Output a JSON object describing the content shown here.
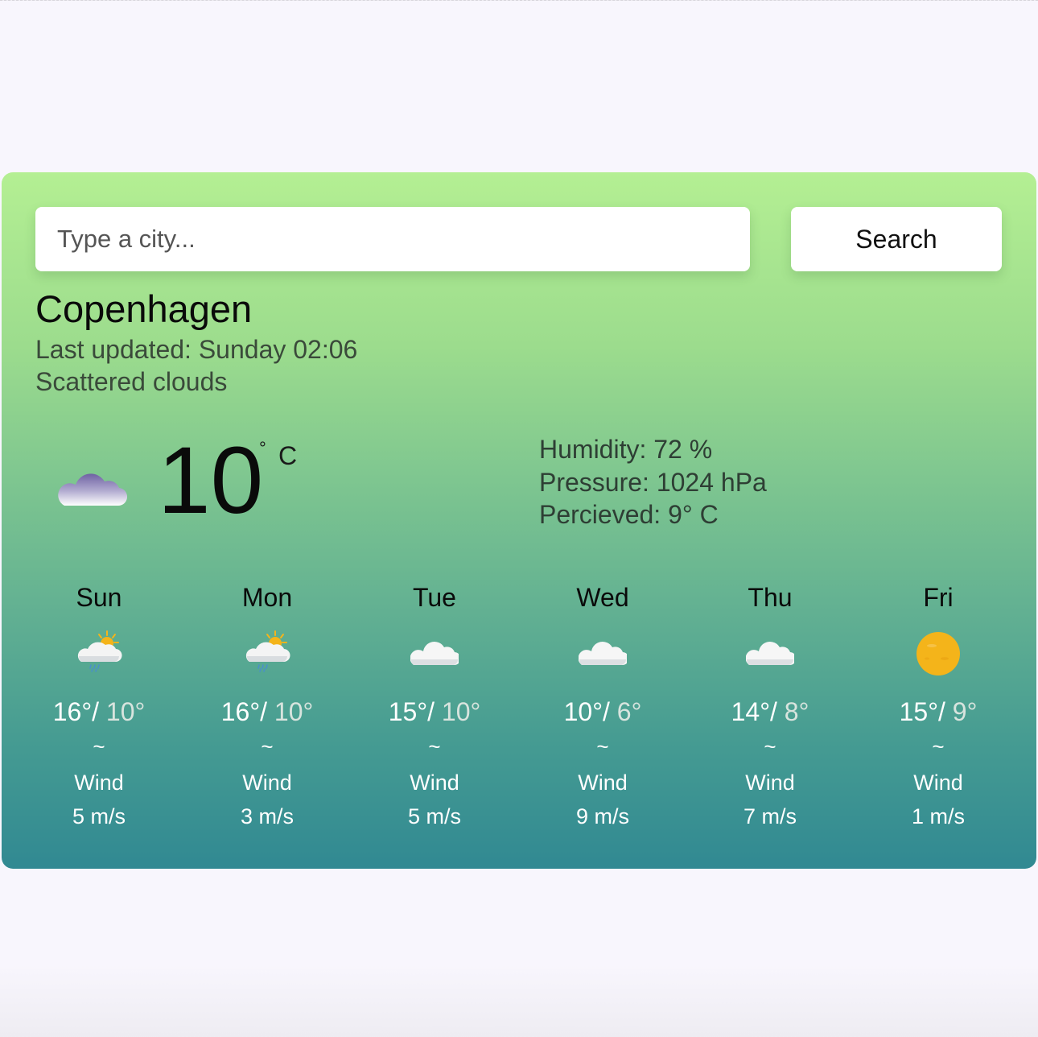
{
  "search": {
    "placeholder": "Type a city...",
    "button_label": "Search"
  },
  "current": {
    "city": "Copenhagen",
    "last_updated": "Last updated: Sunday 02:06",
    "description": "Scattered clouds",
    "icon": "cloud-icon",
    "temperature": "10",
    "degree_symbol": "°",
    "unit": "C",
    "humidity": "Humidity: 72 %",
    "pressure": "Pressure: 1024 hPa",
    "perceived": "Percieved: 9° C"
  },
  "forecast": [
    {
      "day": "Sun",
      "icon": "sun-cloud-rain-icon",
      "max": "16°",
      "min": "10°",
      "tilde": "~",
      "wind_label": "Wind",
      "wind": "5 m/s"
    },
    {
      "day": "Mon",
      "icon": "sun-cloud-rain-icon",
      "max": "16°",
      "min": "10°",
      "tilde": "~",
      "wind_label": "Wind",
      "wind": "3 m/s"
    },
    {
      "day": "Tue",
      "icon": "cloud-icon",
      "max": "15°",
      "min": "10°",
      "tilde": "~",
      "wind_label": "Wind",
      "wind": "5 m/s"
    },
    {
      "day": "Wed",
      "icon": "cloud-icon",
      "max": "10°",
      "min": "6°",
      "tilde": "~",
      "wind_label": "Wind",
      "wind": "9 m/s"
    },
    {
      "day": "Thu",
      "icon": "cloud-icon",
      "max": "14°",
      "min": "8°",
      "tilde": "~",
      "wind_label": "Wind",
      "wind": "7 m/s"
    },
    {
      "day": "Fri",
      "icon": "sun-icon",
      "max": "15°",
      "min": "9°",
      "tilde": "~",
      "wind_label": "Wind",
      "wind": "1 m/s"
    }
  ],
  "colors": {
    "gradient_top": "#b4ef93",
    "gradient_bottom": "#318992",
    "sun": "#f4b41a"
  }
}
